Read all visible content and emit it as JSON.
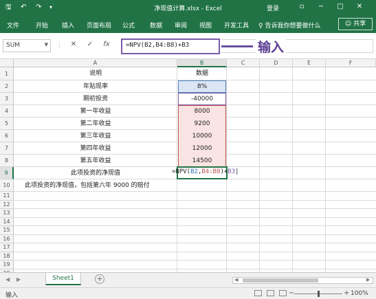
{
  "window": {
    "title": "净现值计算.xlsx - Excel",
    "login": "登录",
    "quick_access": [
      "save-icon",
      "undo-icon",
      "redo-icon",
      "customize-icon"
    ],
    "controls": [
      "restore-ribbon-icon",
      "minimize-icon",
      "maximize-icon",
      "close-icon"
    ]
  },
  "ribbon": {
    "tabs": [
      "文件",
      "开始",
      "插入",
      "页面布局",
      "公式",
      "数据",
      "审阅",
      "视图",
      "开发工具"
    ],
    "tell_me": "♀ 告诉我你想要做什么",
    "share": "共享"
  },
  "formula_bar": {
    "name_box": "SUM",
    "cancel": "✕",
    "enter": "✓",
    "fx": "fx",
    "formula": "=NPV(B2,B4:B8)+B3"
  },
  "annotation": {
    "text": "输入"
  },
  "columns": [
    "A",
    "B",
    "C",
    "D",
    "E",
    "F"
  ],
  "rows": [
    "1",
    "2",
    "3",
    "4",
    "5",
    "6",
    "7",
    "8",
    "9",
    "10",
    "11",
    "12",
    "13",
    "14",
    "15",
    "16",
    "17",
    "18",
    "19",
    "20"
  ],
  "cells": {
    "A1": "说明",
    "B1": "数据",
    "A2": "年贴现率",
    "B2": "8%",
    "A3": "期初投资",
    "B3": "-40000",
    "A4": "第一年收益",
    "B4": "8000",
    "A5": "第二年收益",
    "B5": "9200",
    "A6": "第三年收益",
    "B6": "10000",
    "A7": "第四年收益",
    "B7": "12000",
    "A8": "第五年收益",
    "B8": "14500",
    "A9": "此项投资的净现值",
    "A10": "此项投资的净现值，包括第六年 9000 的赔付"
  },
  "editing": {
    "prefix": "=NPV(",
    "ref1": "B2",
    "sep": ",",
    "ref2": "B4:B8",
    "mid": ")+",
    "ref3": "B3"
  },
  "sheets": {
    "active": "Sheet1",
    "add": "+"
  },
  "status": {
    "mode": "输入",
    "zoom": "100%"
  }
}
